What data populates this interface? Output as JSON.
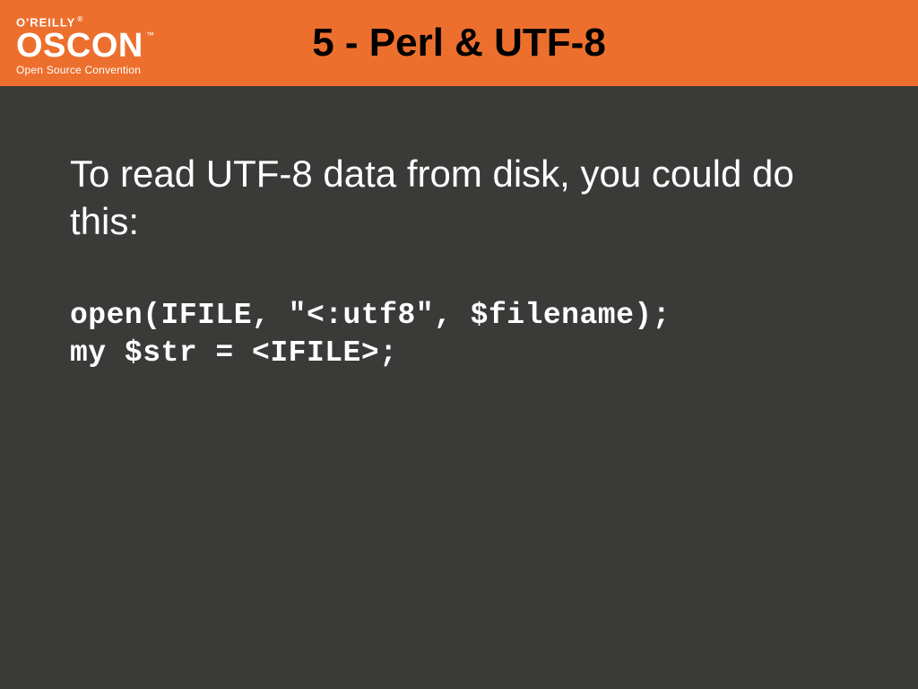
{
  "header": {
    "logo_top": "O'REILLY",
    "logo_reg": "®",
    "logo_main": "OSCON",
    "logo_tm": "™",
    "logo_sub": "Open Source Convention",
    "title": "5 - Perl & UTF-8"
  },
  "body": {
    "intro": "To read UTF-8 data from disk, you could do this:",
    "code_line1": "open(IFILE, \"<:utf8\", $filename);",
    "code_line2": "my $str = <IFILE>;"
  }
}
